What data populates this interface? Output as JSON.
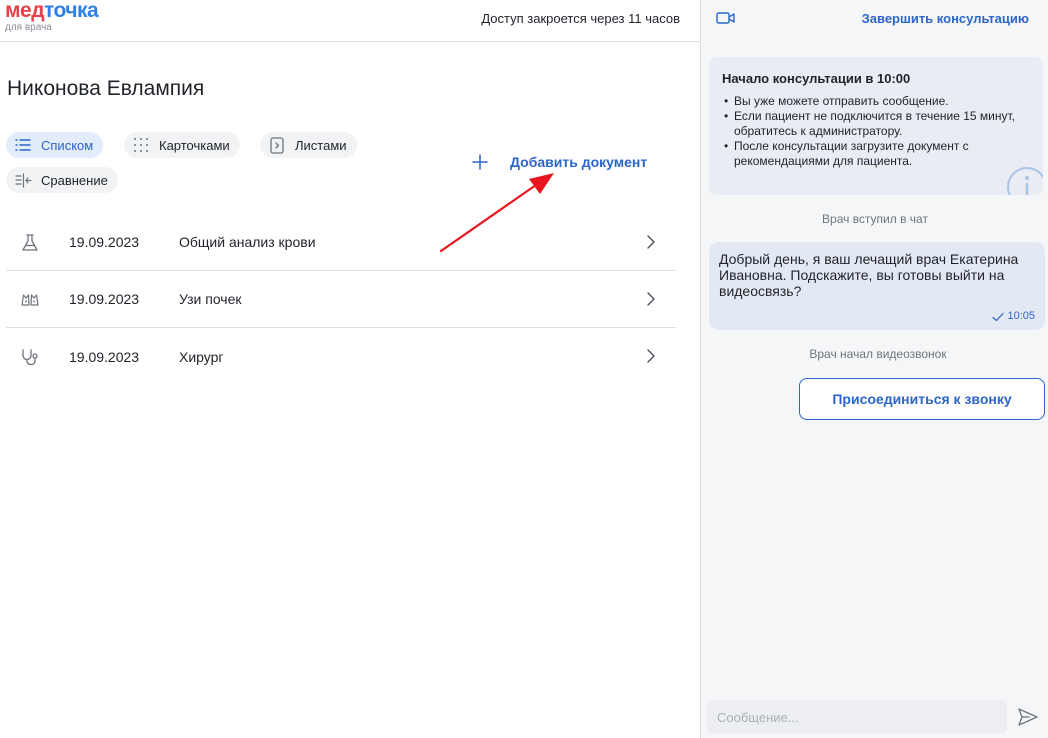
{
  "header": {
    "logo_part1": "мед",
    "logo_part2": "точка",
    "logo_sub": "для врача",
    "access_text": "Доступ закроется через 11 часов"
  },
  "patient": {
    "name": "Никонова Евлампия"
  },
  "view_tabs": [
    {
      "label": "Списком",
      "icon": "list-icon",
      "active": true
    },
    {
      "label": "Карточками",
      "icon": "grid-dots-icon",
      "active": false
    },
    {
      "label": "Листами",
      "icon": "page-icon",
      "active": false
    },
    {
      "label": "Сравнение",
      "icon": "compare-icon",
      "active": false
    }
  ],
  "actions": {
    "add_document": "Добавить документ"
  },
  "documents": [
    {
      "date": "19.09.2023",
      "title": "Общий анализ крови",
      "icon": "flask-icon"
    },
    {
      "date": "19.09.2023",
      "title": "Узи почек",
      "icon": "kidneys-icon"
    },
    {
      "date": "19.09.2023",
      "title": "Хирург",
      "icon": "stethoscope-icon"
    }
  ],
  "chat": {
    "end_consultation": "Завершить консультацию",
    "info": {
      "title": "Начало консультации в 10:00",
      "items": [
        "Вы уже можете отправить сообщение.",
        "Если пациент не подключится в течение 15 минут, обратитесь к администратору.",
        "После консультации загрузите документ с рекомендациями для пациента."
      ]
    },
    "system_joined": "Врач вступил в чат",
    "message": {
      "text": "Добрый день, я ваш лечащий врач Екатерина Ивановна. Подскажите, вы готовы выйти на видеосвязь?",
      "time": "10:05"
    },
    "system_video": "Врач начал видеозвонок",
    "join_call": "Присоединиться к звонку",
    "input_placeholder": "Сообщение..."
  },
  "colors": {
    "accent": "#2b66c9",
    "logo_red": "#e8414a",
    "logo_blue": "#2f7fe6",
    "annotation_arrow": "#e8141e"
  }
}
